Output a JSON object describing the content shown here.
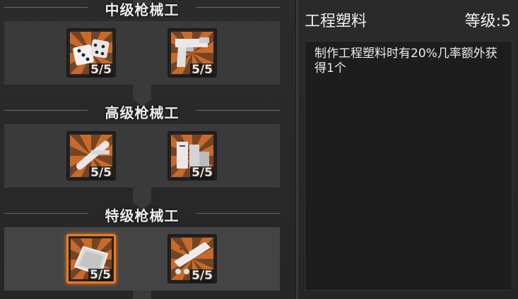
{
  "tiers": [
    {
      "title": "中级枪械工",
      "skills": [
        {
          "icon": "dice-icon",
          "level": "5/5"
        },
        {
          "icon": "pistol-icon",
          "level": "5/5"
        }
      ]
    },
    {
      "title": "高级枪械工",
      "skills": [
        {
          "icon": "pipe-icon",
          "level": "5/5"
        },
        {
          "icon": "crate-icon",
          "level": "5/5"
        }
      ]
    },
    {
      "title": "特级枪械工",
      "skills": [
        {
          "icon": "plastic-sheet-icon",
          "level": "5/5"
        },
        {
          "icon": "rail-icon",
          "level": "5/5"
        }
      ]
    }
  ],
  "detail": {
    "title": "工程塑料",
    "level": "等级:5",
    "description": "制作工程塑料时有20%几率额外获得1个"
  },
  "colors": {
    "accent": "#f07a1a",
    "icon_bg": "#c96a2a"
  }
}
